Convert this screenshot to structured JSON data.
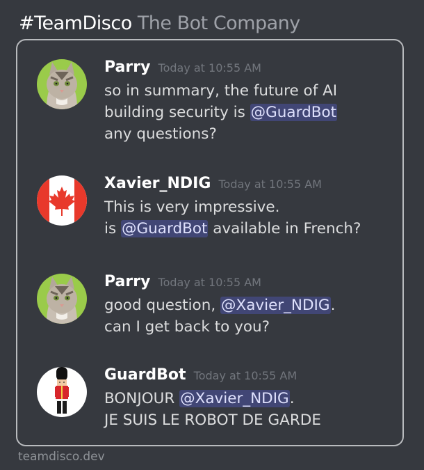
{
  "header": {
    "channel": "#TeamDisco",
    "company": "The Bot Company"
  },
  "footer": {
    "site": "teamdisco.dev"
  },
  "colors": {
    "background": "#36393f",
    "mention_bg": "#414675",
    "mention_text": "#dee0fc",
    "frame_border": "#b9bbbe"
  },
  "messages": [
    {
      "author": "Parry",
      "timestamp": "Today at 10:55 AM",
      "avatar": "cat-avatar",
      "lines": [
        {
          "pre": "so in summary, the future of AI",
          "mention": "",
          "post": ""
        },
        {
          "pre": "building security is ",
          "mention": "@GuardBot",
          "post": ""
        },
        {
          "pre": "any questions?",
          "mention": "",
          "post": ""
        }
      ]
    },
    {
      "author": "Xavier_NDIG",
      "timestamp": "Today at 10:55 AM",
      "avatar": "canada-flag-avatar",
      "lines": [
        {
          "pre": "This is very impressive.",
          "mention": "",
          "post": ""
        },
        {
          "pre": "is ",
          "mention": "@GuardBot",
          "post": " available in French?"
        }
      ]
    },
    {
      "author": "Parry",
      "timestamp": "Today at 10:55 AM",
      "avatar": "cat-avatar",
      "lines": [
        {
          "pre": "good question, ",
          "mention": "@Xavier_NDIG",
          "post": "."
        },
        {
          "pre": "can I get back to you?",
          "mention": "",
          "post": ""
        }
      ]
    },
    {
      "author": "GuardBot",
      "timestamp": "Today at 10:55 AM",
      "avatar": "royal-guard-avatar",
      "lines": [
        {
          "pre": "BONJOUR ",
          "mention": "@Xavier_NDIG",
          "post": "."
        },
        {
          "pre": "JE SUIS LE ROBOT DE GARDE",
          "mention": "",
          "post": ""
        }
      ]
    }
  ]
}
